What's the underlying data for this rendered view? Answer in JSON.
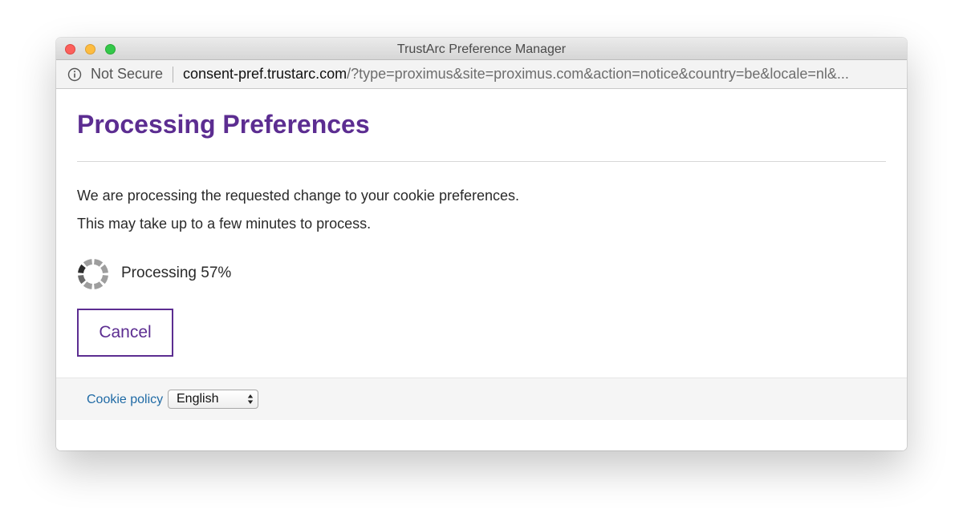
{
  "window": {
    "title": "TrustArc Preference Manager"
  },
  "address_bar": {
    "security_label": "Not Secure",
    "url_host": "consent-pref.trustarc.com",
    "url_rest": "/?type=proximus&site=proximus.com&action=notice&country=be&locale=nl&..."
  },
  "page": {
    "title": "Processing Preferences",
    "message_line1": "We are processing the requested change to your cookie preferences.",
    "message_line2": "This may take up to a few minutes to process.",
    "progress_label": "Processing 57%",
    "progress_value": 57,
    "cancel_label": "Cancel"
  },
  "footer": {
    "cookie_policy_label": "Cookie policy",
    "language_selected": "English"
  },
  "icons": {
    "info": "info-circle-icon",
    "spinner": "loading-spinner-icon",
    "select_arrows": "up-down-arrows-icon"
  },
  "colors": {
    "brand_purple": "#5c2d91",
    "link_blue": "#1f6aa5",
    "close": "#fc605c",
    "minimize": "#fdbc40",
    "maximize": "#34c84a"
  }
}
